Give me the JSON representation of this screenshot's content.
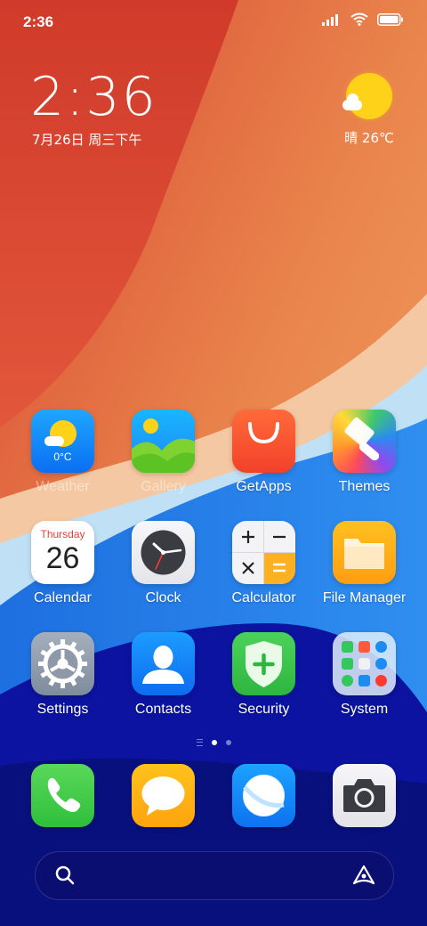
{
  "status_bar": {
    "time": "2:36"
  },
  "clock_widget": {
    "time": "2:36",
    "date": "7月26日 周三下午"
  },
  "weather_widget": {
    "text": "晴 26℃"
  },
  "apps": [
    {
      "id": "weather",
      "label": "Weather",
      "icon": "weather-icon",
      "badge": "0°C"
    },
    {
      "id": "gallery",
      "label": "Gallery",
      "icon": "gallery-icon"
    },
    {
      "id": "getapps",
      "label": "GetApps",
      "icon": "shopping-bag-icon"
    },
    {
      "id": "themes",
      "label": "Themes",
      "icon": "paintbrush-icon"
    },
    {
      "id": "calendar",
      "label": "Calendar",
      "icon": "calendar-icon",
      "day_name": "Thursday",
      "day_number": "26"
    },
    {
      "id": "clock",
      "label": "Clock",
      "icon": "clock-icon"
    },
    {
      "id": "calculator",
      "label": "Calculator",
      "icon": "calculator-icon"
    },
    {
      "id": "file-manager",
      "label": "File Manager",
      "icon": "folder-icon"
    },
    {
      "id": "settings",
      "label": "Settings",
      "icon": "gear-icon"
    },
    {
      "id": "contacts",
      "label": "Contacts",
      "icon": "person-icon"
    },
    {
      "id": "security",
      "label": "Security",
      "icon": "shield-plus-icon"
    },
    {
      "id": "system",
      "label": "System",
      "icon": "app-folder-icon"
    }
  ],
  "page_indicator": {
    "pages": 2,
    "current": 1
  },
  "dock": [
    {
      "id": "phone",
      "icon": "phone-icon"
    },
    {
      "id": "messages",
      "icon": "chat-bubble-icon"
    },
    {
      "id": "browser",
      "icon": "browser-icon"
    },
    {
      "id": "camera",
      "icon": "camera-icon"
    }
  ],
  "search_bar": {
    "left_icon": "search-icon",
    "right_icon": "assistant-icon"
  }
}
